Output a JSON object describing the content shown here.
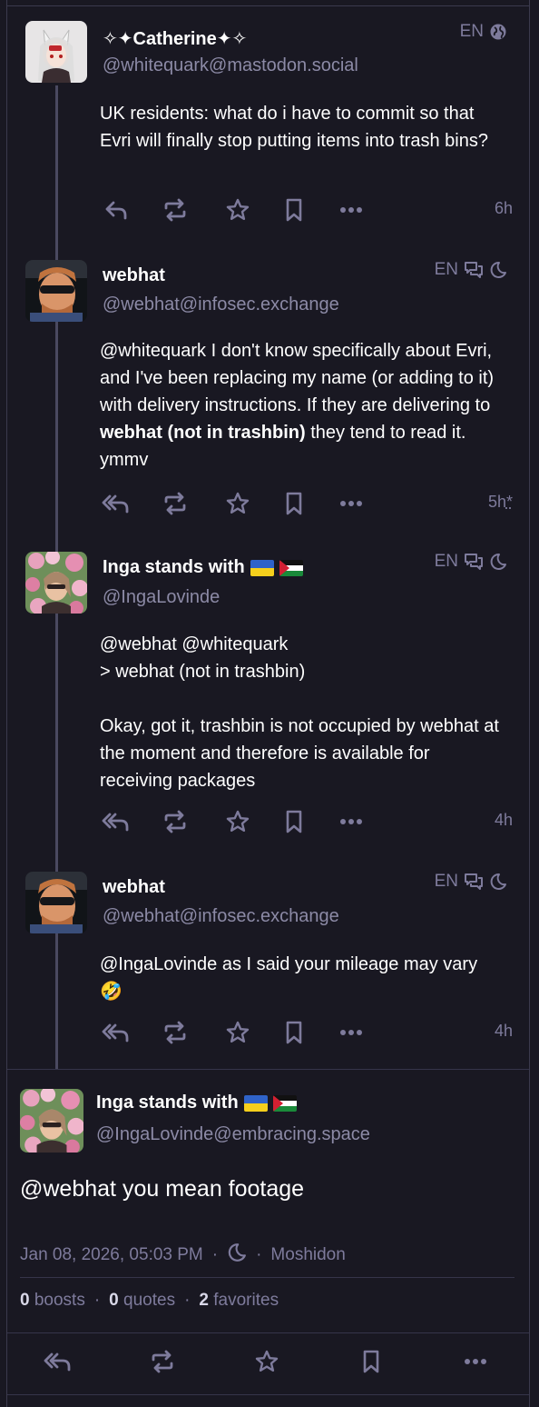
{
  "posts": [
    {
      "name": "✧✦Catherine✦✧",
      "handle": "@whitequark@mastodon.social",
      "lang": "EN",
      "paragraphs": [
        "UK residents: what do i have to commit so that Evri will finally stop putting items into trash bins?"
      ],
      "time": "6h"
    },
    {
      "name": "webhat",
      "handle": "@webhat@infosec.exchange",
      "lang": "EN",
      "content_pre": "@whitequark I don't know specifically about Evri, and I've been replacing my name (or adding to it) with delivery instructions. If they are delivering to ",
      "content_bold": "webhat (not in trashbin)",
      "content_post": " they tend to read it. ymmv",
      "time": "5h",
      "edited": "*"
    },
    {
      "name": "Inga stands with",
      "handle": "@IngaLovinde",
      "lang": "EN",
      "line1": "@webhat @whitequark",
      "line2": "> webhat (not in trashbin)",
      "line3": "Okay, got it, trashbin is not occupied by webhat at the moment and therefore is available for receiving packages",
      "time": "4h"
    },
    {
      "name": "webhat",
      "handle": "@webhat@infosec.exchange",
      "lang": "EN",
      "content": "@IngaLovinde as I said your mileage may vary 🤣",
      "time": "4h"
    }
  ],
  "focus": {
    "name": "Inga stands with",
    "handle": "@IngaLovinde@embracing.space",
    "content": "@webhat you mean footage",
    "date": "Jan 08, 2026, 05:03 PM",
    "app": "Moshidon",
    "boosts_count": "0",
    "boosts_label": "boosts",
    "quotes_count": "0",
    "quotes_label": "quotes",
    "favorites_count": "2",
    "favorites_label": "favorites",
    "dot": "·"
  },
  "icons": [
    "reply-icon",
    "reply-all-icon",
    "boost-icon",
    "favorite-icon",
    "bookmark-icon",
    "more-icon",
    "globe-icon",
    "conversation-icon",
    "moon-icon"
  ],
  "colors": {
    "background": "#191822",
    "muted": "#7e7b9c",
    "handle": "#8c8aa6",
    "line": "#4a4960"
  }
}
